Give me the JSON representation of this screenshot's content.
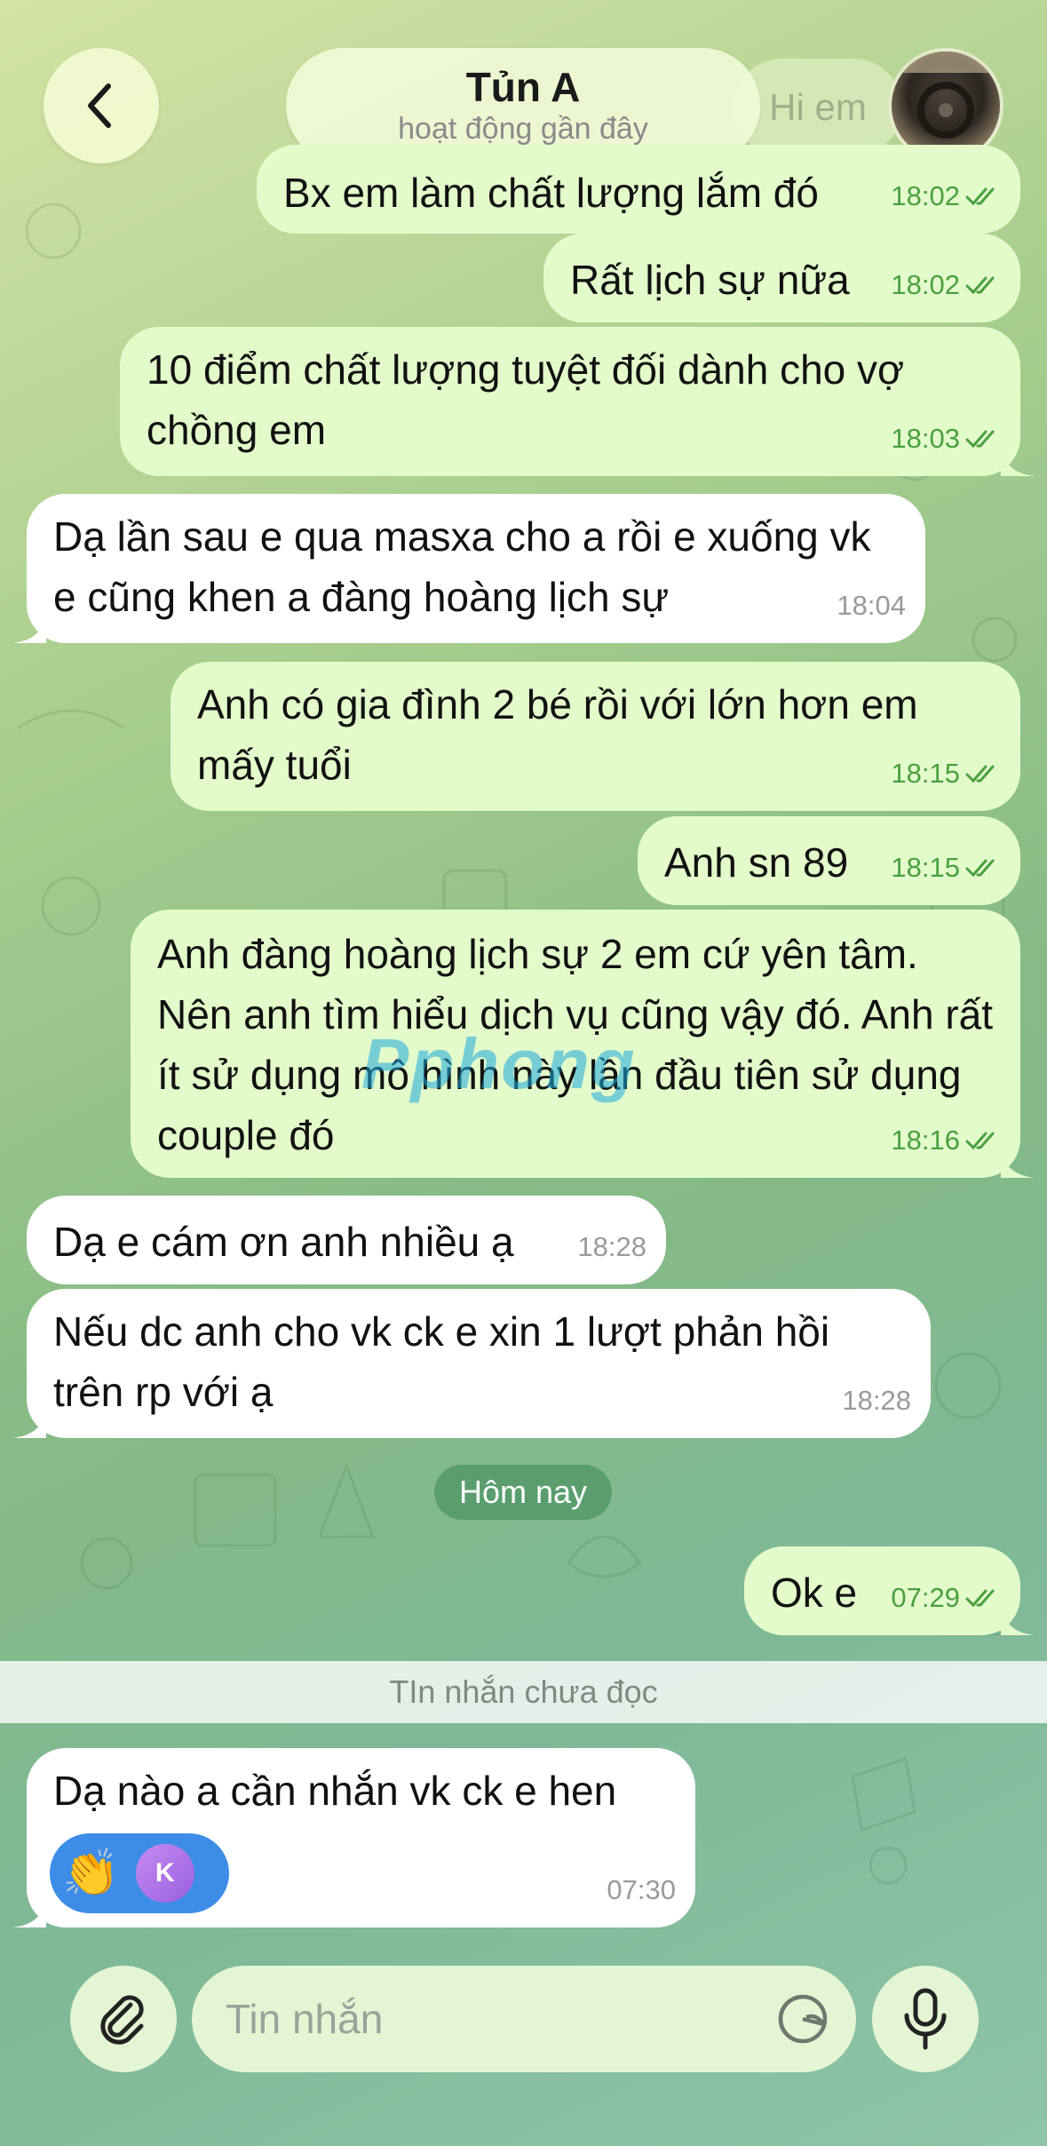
{
  "header": {
    "back_label": "‹",
    "contact_name": "Tủn A",
    "status": "hoạt động gần đây",
    "ghost_text": "Hi em"
  },
  "messages": [
    {
      "dir": "out",
      "text": "Bx em làm chất lượng lắm đó",
      "time": "18:02",
      "read": true
    },
    {
      "dir": "out",
      "text": "Rất lịch sự nữa",
      "time": "18:02",
      "read": true
    },
    {
      "dir": "out",
      "text": "10 điểm chất lượng tuyệt đối dành cho vợ chồng em",
      "time": "18:03",
      "read": true
    },
    {
      "dir": "in",
      "text": "Dạ lần sau e qua masxa cho a rồi e xuống vk e cũng khen a đàng hoàng lịch sự",
      "time": "18:04"
    },
    {
      "dir": "out",
      "text": "Anh có gia đình 2 bé rồi với lớn hơn em mấy tuổi",
      "time": "18:15",
      "read": true
    },
    {
      "dir": "out",
      "text": "Anh sn 89",
      "time": "18:15",
      "read": true
    },
    {
      "dir": "out",
      "text": "Anh đàng hoàng lịch sự 2 em cứ yên tâm. Nên anh tìm hiểu dịch vụ cũng vậy đó. Anh rất ít sử dụng mô hình này lần đầu tiên sử dụng couple đó",
      "time": "18:16",
      "read": true
    },
    {
      "dir": "in",
      "text": "Dạ e cám ơn anh nhiều ạ",
      "time": "18:28"
    },
    {
      "dir": "in",
      "text": "Nếu dc anh cho vk ck e xin 1 lượt phản hồi trên rp với ạ",
      "time": "18:28"
    },
    {
      "dir": "out",
      "text": "Ok e",
      "time": "07:29",
      "read": true
    },
    {
      "dir": "in",
      "text": "Dạ nào a cần nhắn vk ck e hen",
      "time": "07:30",
      "reaction": {
        "emoji": "👏",
        "avatar_letter": "K"
      }
    }
  ],
  "date_divider": "Hôm nay",
  "unread_divider": "TIn nhắn chưa đọc",
  "watermark": "Pphong",
  "input": {
    "placeholder": "Tin nhắn"
  },
  "colors": {
    "outgoing_bubble": "#e3fbcb",
    "incoming_bubble": "#ffffff",
    "timestamp_out": "#4aa03f",
    "date_pill": "#5a9e6e",
    "reaction_pill": "#3d8de8"
  },
  "icons": [
    "back-icon",
    "read-checks-icon",
    "paperclip-icon",
    "sticker-icon",
    "mic-icon"
  ]
}
